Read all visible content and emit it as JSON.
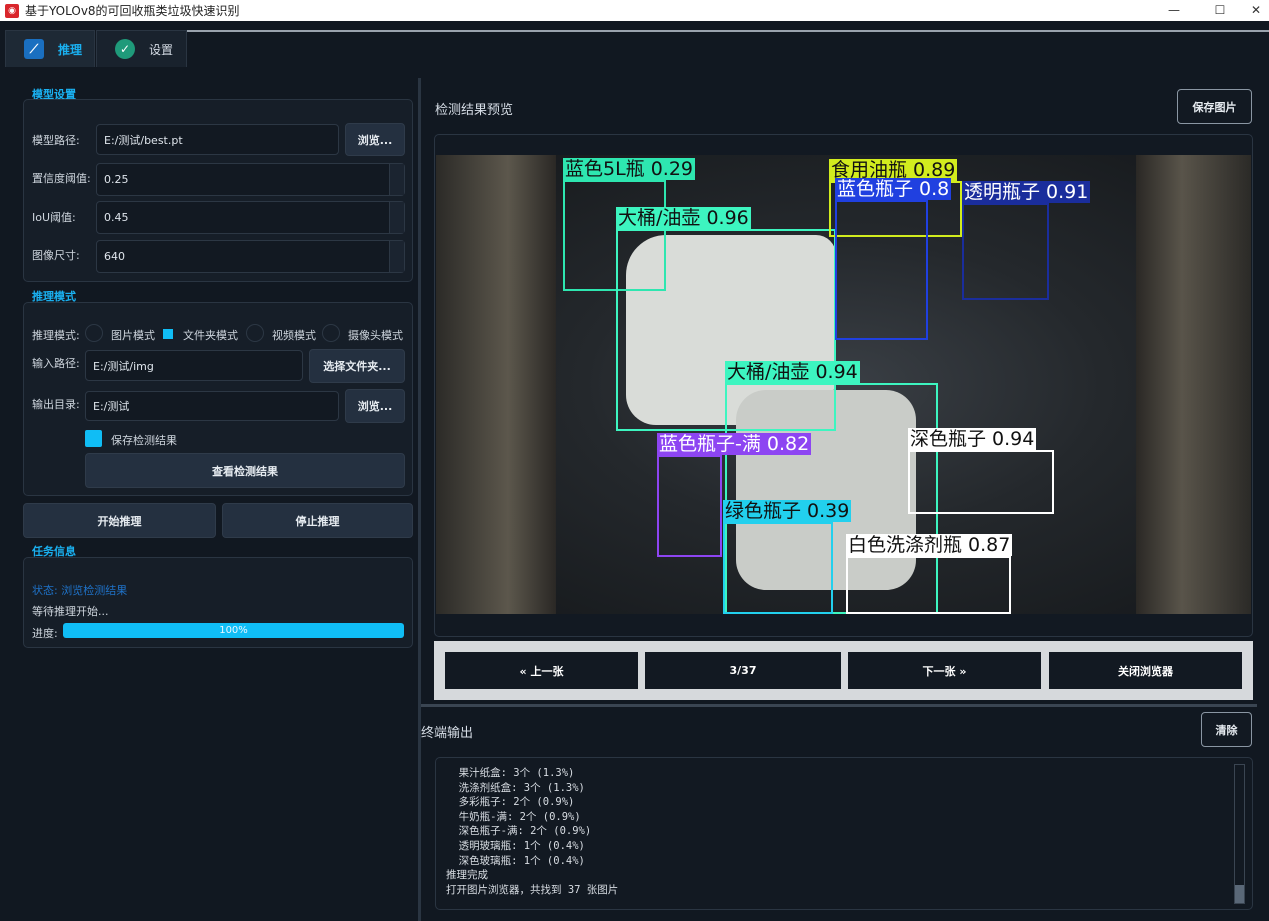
{
  "window": {
    "title": "基于YOLOv8的可回收瓶类垃圾快速识别",
    "logo": "app-logo",
    "minimize": "—",
    "maximize": "☐",
    "close": "✕"
  },
  "tabs": [
    {
      "label": "推理",
      "icon": "chart-line-icon"
    },
    {
      "label": "设置",
      "icon": "check-circle-icon"
    }
  ],
  "model": {
    "section": "模型设置",
    "path_label": "模型路径:",
    "path_value": "E:/测试/best.pt",
    "browse": "浏览...",
    "conf_label": "置信度阈值:",
    "conf_value": "0.25",
    "iou_label": "IoU阈值:",
    "iou_value": "0.45",
    "size_label": "图像尺寸:",
    "size_value": "640"
  },
  "mode": {
    "section": "推理模式",
    "mode_label": "推理模式:",
    "options": [
      {
        "label": "图片模式",
        "selected": false
      },
      {
        "label": "文件夹模式",
        "selected": true
      },
      {
        "label": "视频模式",
        "selected": false
      },
      {
        "label": "摄像头模式",
        "selected": false
      }
    ],
    "input_label": "输入路径:",
    "input_value": "E:/测试/img",
    "select_folder": "选择文件夹...",
    "output_label": "输出目录:",
    "output_value": "E:/测试",
    "browse": "浏览...",
    "save_label": "保存检测结果",
    "save_checked": true,
    "view_results": "查看检测结果"
  },
  "actions": {
    "start": "开始推理",
    "stop": "停止推理"
  },
  "task": {
    "section": "任务信息",
    "status": "状态: 浏览检测结果",
    "message": "等待推理开始...",
    "progress_label": "进度:",
    "progress_text": "100%",
    "progress": 100
  },
  "preview": {
    "title": "检测结果预览",
    "save": "保存图片",
    "detections": [
      {
        "label": "蓝色5L瓶 0.29",
        "color": "#2ee6b0"
      },
      {
        "label": "大桶/油壶 0.96",
        "color": "#3df5c0"
      },
      {
        "label": "食用油瓶 0.89",
        "color": "#d2ec1e"
      },
      {
        "label": "蓝色瓶子 0.8",
        "color": "#2040e0"
      },
      {
        "label": "透明瓶子 0.91",
        "color": "#1a2d9c"
      },
      {
        "label": "大桶/油壶 0.94",
        "color": "#3df5c0"
      },
      {
        "label": "蓝色瓶子-满 0.82",
        "color": "#8d45f2"
      },
      {
        "label": "深色瓶子 0.94",
        "color": "#ffffff"
      },
      {
        "label": "绿色瓶子 0.39",
        "color": "#22d0ee"
      },
      {
        "label": "白色洗涤剂瓶 0.87",
        "color": "#ffffff"
      }
    ]
  },
  "browser": {
    "prev": "« 上一张",
    "counter": "3/37",
    "next": "下一张 »",
    "close": "关闭浏览器"
  },
  "terminal": {
    "title": "终端输出",
    "clear": "清除",
    "lines": [
      "  果汁纸盒: 3个 (1.3%)",
      "  洗涤剂纸盒: 3个 (1.3%)",
      "  多彩瓶子: 2个 (0.9%)",
      "  牛奶瓶-满: 2个 (0.9%)",
      "  深色瓶子-满: 2个 (0.9%)",
      "  透明玻璃瓶: 1个 (0.4%)",
      "  深色玻璃瓶: 1个 (0.4%)",
      "推理完成",
      "打开图片浏览器，共找到 37 张图片"
    ]
  }
}
